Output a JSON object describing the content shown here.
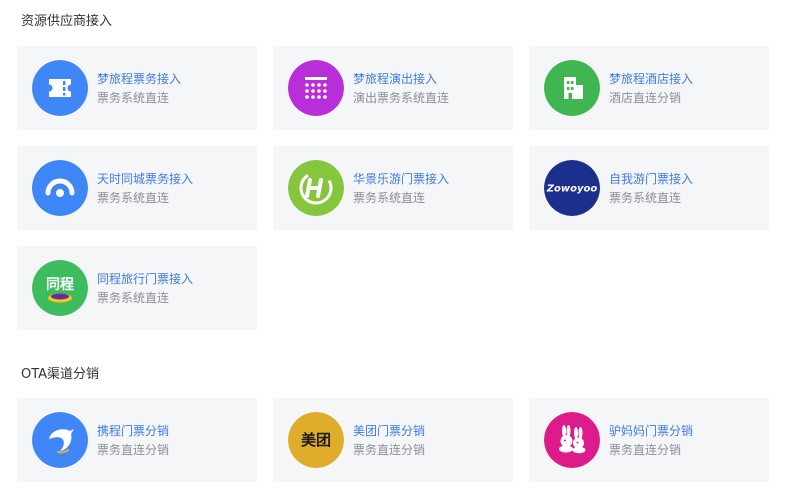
{
  "sections": [
    {
      "title": "资源供应商接入",
      "cards": [
        {
          "title": "梦旅程票务接入",
          "subtitle": "票务系统直连",
          "icon": "ticket-icon",
          "color": "#3f86f6"
        },
        {
          "title": "梦旅程演出接入",
          "subtitle": "演出票务系统直连",
          "icon": "seat-grid-icon",
          "color": "#b82ed9"
        },
        {
          "title": "梦旅程酒店接入",
          "subtitle": "酒店直连分销",
          "icon": "hotel-building-icon",
          "color": "#3fb651"
        },
        {
          "title": "天时同城票务接入",
          "subtitle": "票务系统直连",
          "icon": "arc-dot-icon",
          "color": "#3f86f6"
        },
        {
          "title": "华景乐游门票接入",
          "subtitle": "票务系统直连",
          "icon": "h-swirl-icon",
          "color": "#86c63d"
        },
        {
          "title": "自我游门票接入",
          "subtitle": "票务系统直连",
          "icon": "zowoyoo-logo",
          "color": "#1d2f8c",
          "logo_text": "Zowoyoo"
        },
        {
          "title": "同程旅行门票接入",
          "subtitle": "票务系统直连",
          "icon": "tongcheng-logo",
          "color": "#3cbc5c",
          "logo_text": "同程"
        }
      ]
    },
    {
      "title": "OTA渠道分销",
      "cards": [
        {
          "title": "携程门票分销",
          "subtitle": "票务直连分销",
          "icon": "dolphin-icon",
          "color": "#3f86f6"
        },
        {
          "title": "美团门票分销",
          "subtitle": "票务直连分销",
          "icon": "meituan-logo",
          "color": "#e0ad2b",
          "logo_text": "美团"
        },
        {
          "title": "驴妈妈门票分销",
          "subtitle": "票务直连分销",
          "icon": "rabbits-icon",
          "color": "#dd1b8a"
        }
      ]
    }
  ]
}
